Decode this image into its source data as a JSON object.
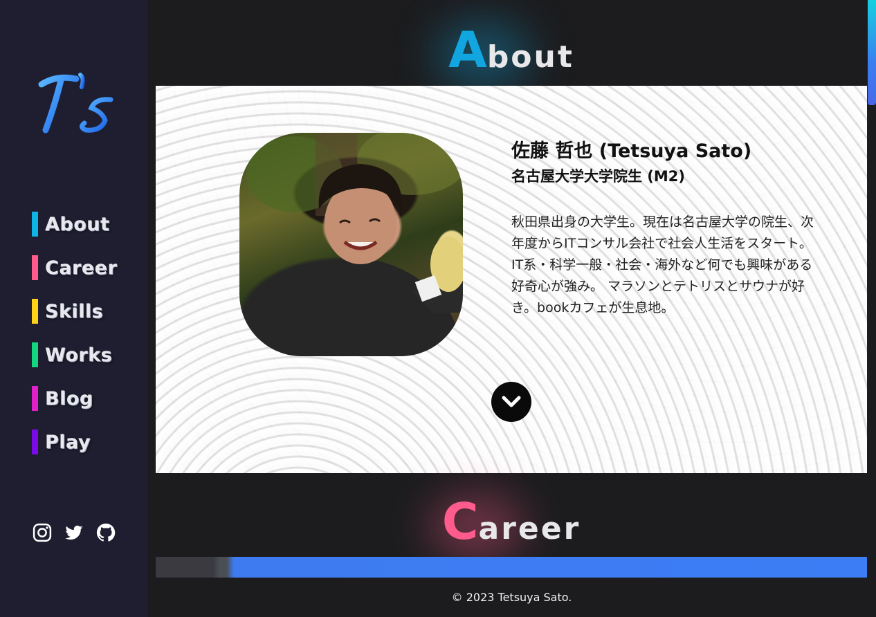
{
  "logo": {
    "text": "T's"
  },
  "nav": {
    "items": [
      {
        "label": "About",
        "color": "#0fb3e6"
      },
      {
        "label": "Career",
        "color": "#ff5b8d"
      },
      {
        "label": "Skills",
        "color": "#ffd21a"
      },
      {
        "label": "Works",
        "color": "#14d67e"
      },
      {
        "label": "Blog",
        "color": "#e020c8"
      },
      {
        "label": "Play",
        "color": "#7a0ae6"
      }
    ]
  },
  "social": {
    "icons": [
      "instagram-icon",
      "twitter-icon",
      "github-icon"
    ]
  },
  "about": {
    "heading_first": "A",
    "heading_rest": "bout",
    "accent_color": "#12a6e0",
    "name": "佐藤 哲也 (Tetsuya Sato)",
    "affiliation": "名古屋大学大学院生 (M2)",
    "bio_lines": [
      "秋田県出身の大学生。現在は名古屋大学の院生、次",
      "年度からITコンサル会社で社会人生活をスタート。",
      "IT系・科学一般・社会・海外など何でも興味がある",
      "好奇心が強み。 マラソンとテトリスとサウナが好",
      "き。bookカフェが生息地。"
    ]
  },
  "career": {
    "heading_first": "C",
    "heading_rest": "areer",
    "accent_color": "#ff5b8d"
  },
  "footer": {
    "text": "© 2023 Tetsuya Sato."
  }
}
